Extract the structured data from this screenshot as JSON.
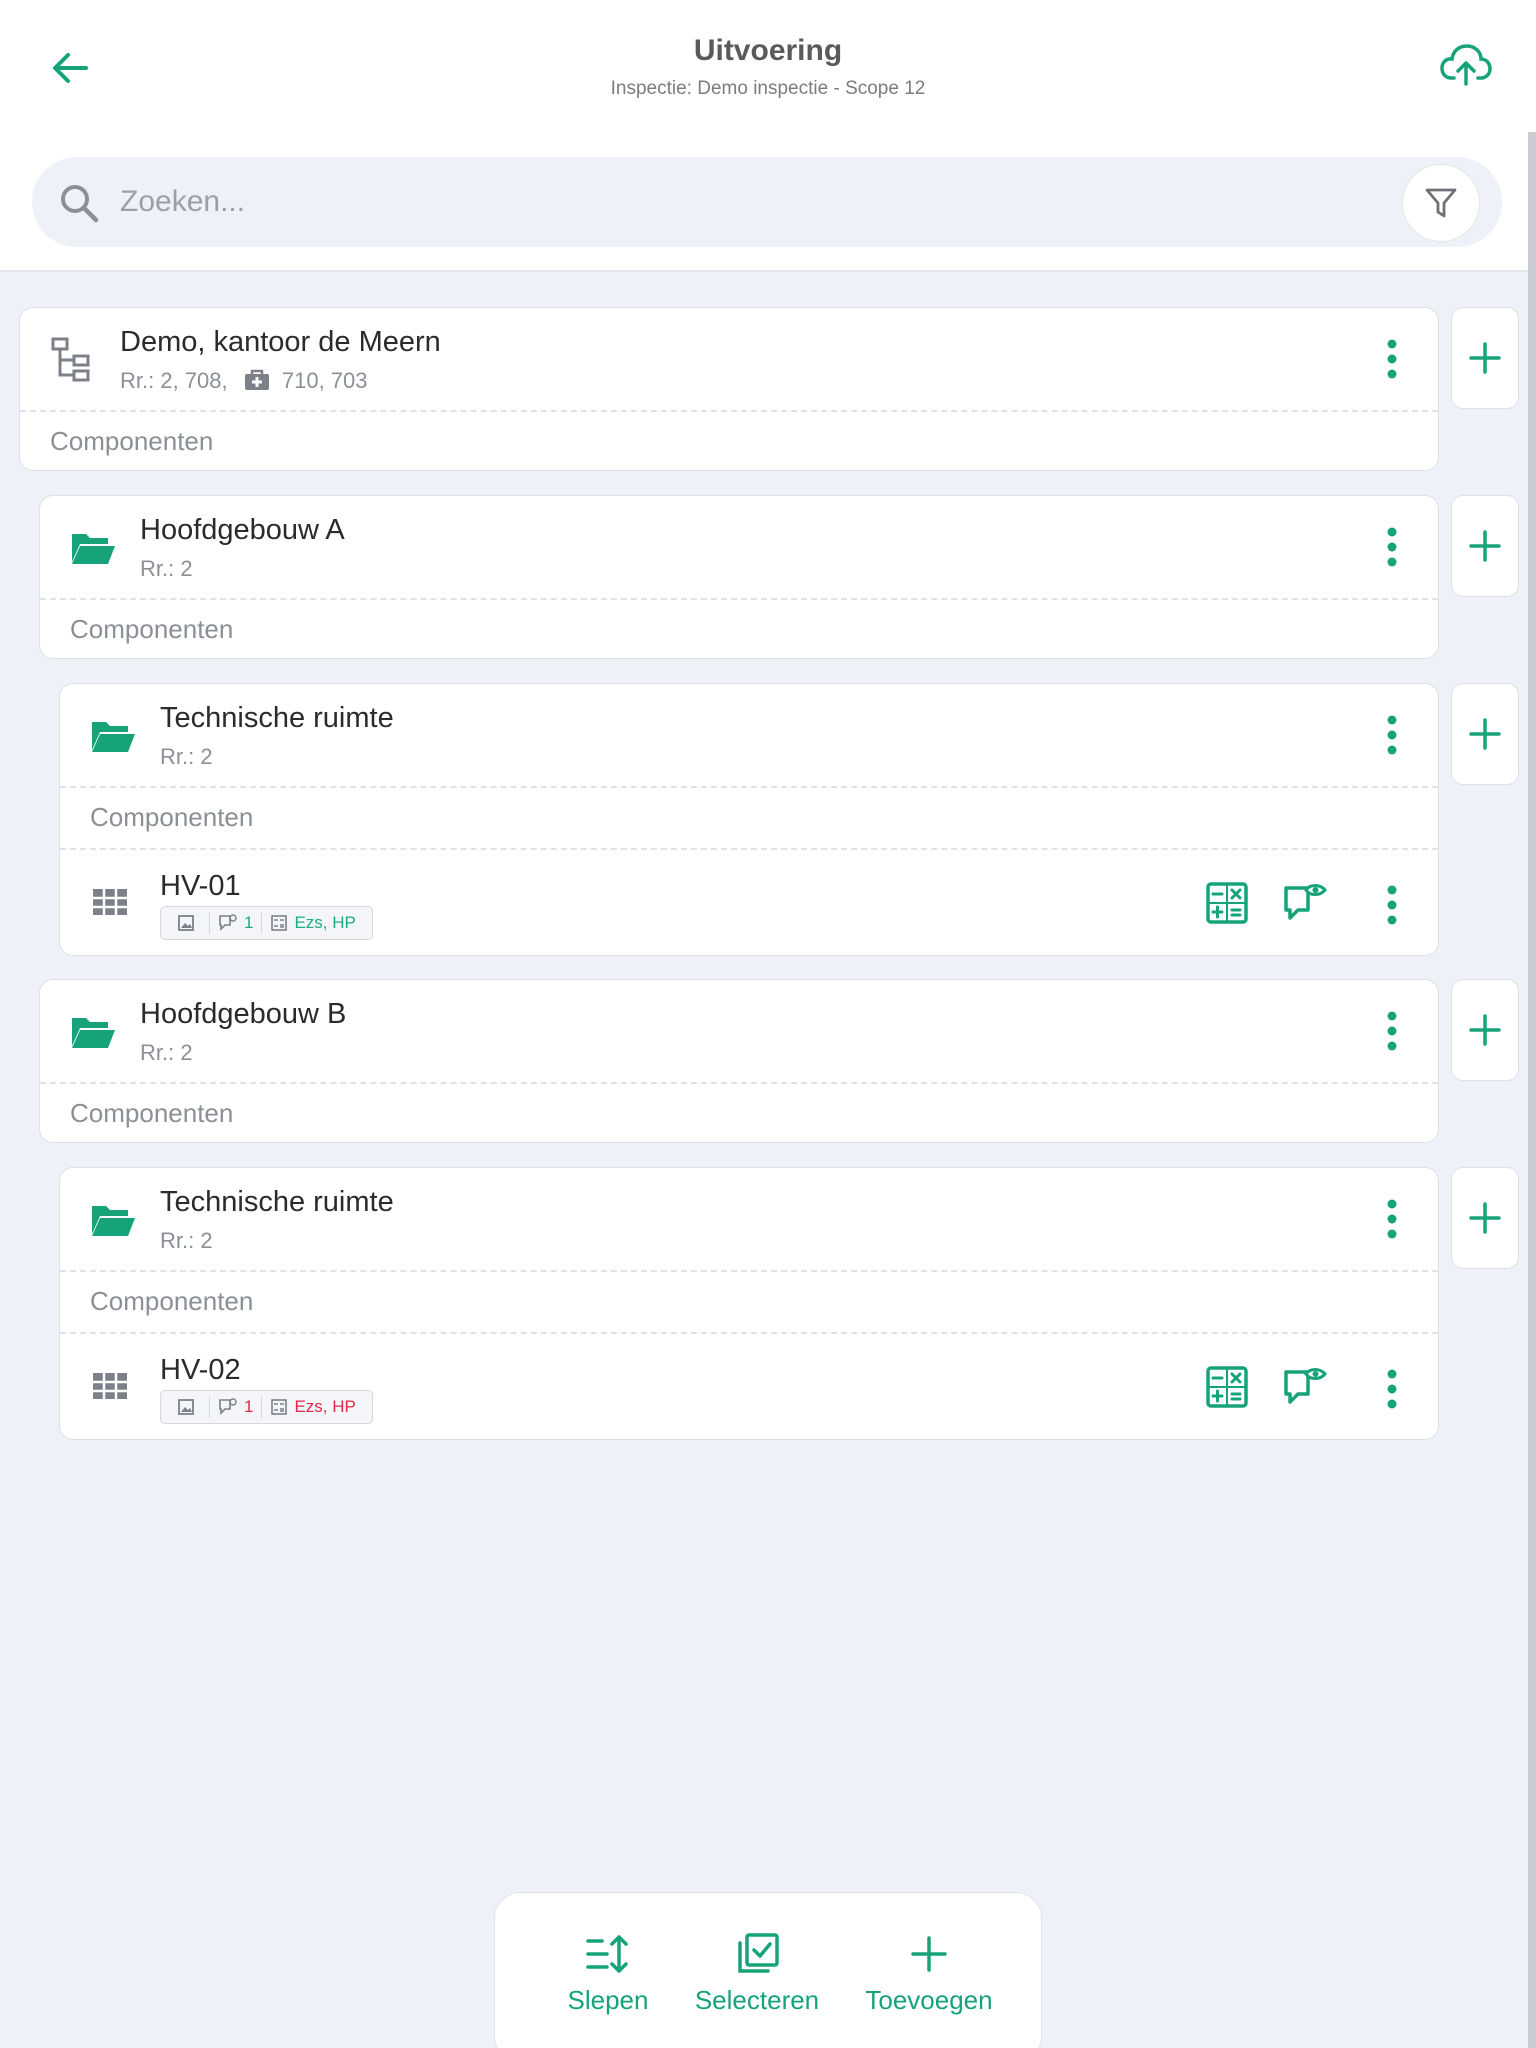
{
  "header": {
    "title": "Uitvoering",
    "subtitle": "Inspectie: Demo inspectie - Scope 12"
  },
  "search": {
    "placeholder": "Zoeken..."
  },
  "colors": {
    "accent": "#17a37a",
    "ok": "#1aae7e",
    "error": "#e0294a",
    "background": "#eef1f8"
  },
  "tree": [
    {
      "title": "Demo, kantoor de Meern",
      "rr_text": "Rr.: 2, 708,",
      "rr_extra": "710, 703",
      "components_label": "Componenten",
      "icon": "hierarchy-icon"
    },
    {
      "title": "Hoofdgebouw A",
      "rr_text": "Rr.: 2",
      "components_label": "Componenten",
      "icon": "folder-open-icon"
    },
    {
      "title": "Technische ruimte",
      "rr_text": "Rr.: 2",
      "components_label": "Componenten",
      "icon": "folder-open-icon",
      "item": {
        "name": "HV-01",
        "remarks_count": "1",
        "labels": "Ezs, HP",
        "status": "ok"
      }
    },
    {
      "title": "Hoofdgebouw B",
      "rr_text": "Rr.: 2",
      "components_label": "Componenten",
      "icon": "folder-open-icon"
    },
    {
      "title": "Technische ruimte",
      "rr_text": "Rr.: 2",
      "components_label": "Componenten",
      "icon": "folder-open-icon",
      "item": {
        "name": "HV-02",
        "remarks_count": "1",
        "labels": "Ezs, HP",
        "status": "error"
      }
    }
  ],
  "bottom_bar": {
    "drag_label": "Slepen",
    "select_label": "Selecteren",
    "add_label": "Toevoegen"
  }
}
